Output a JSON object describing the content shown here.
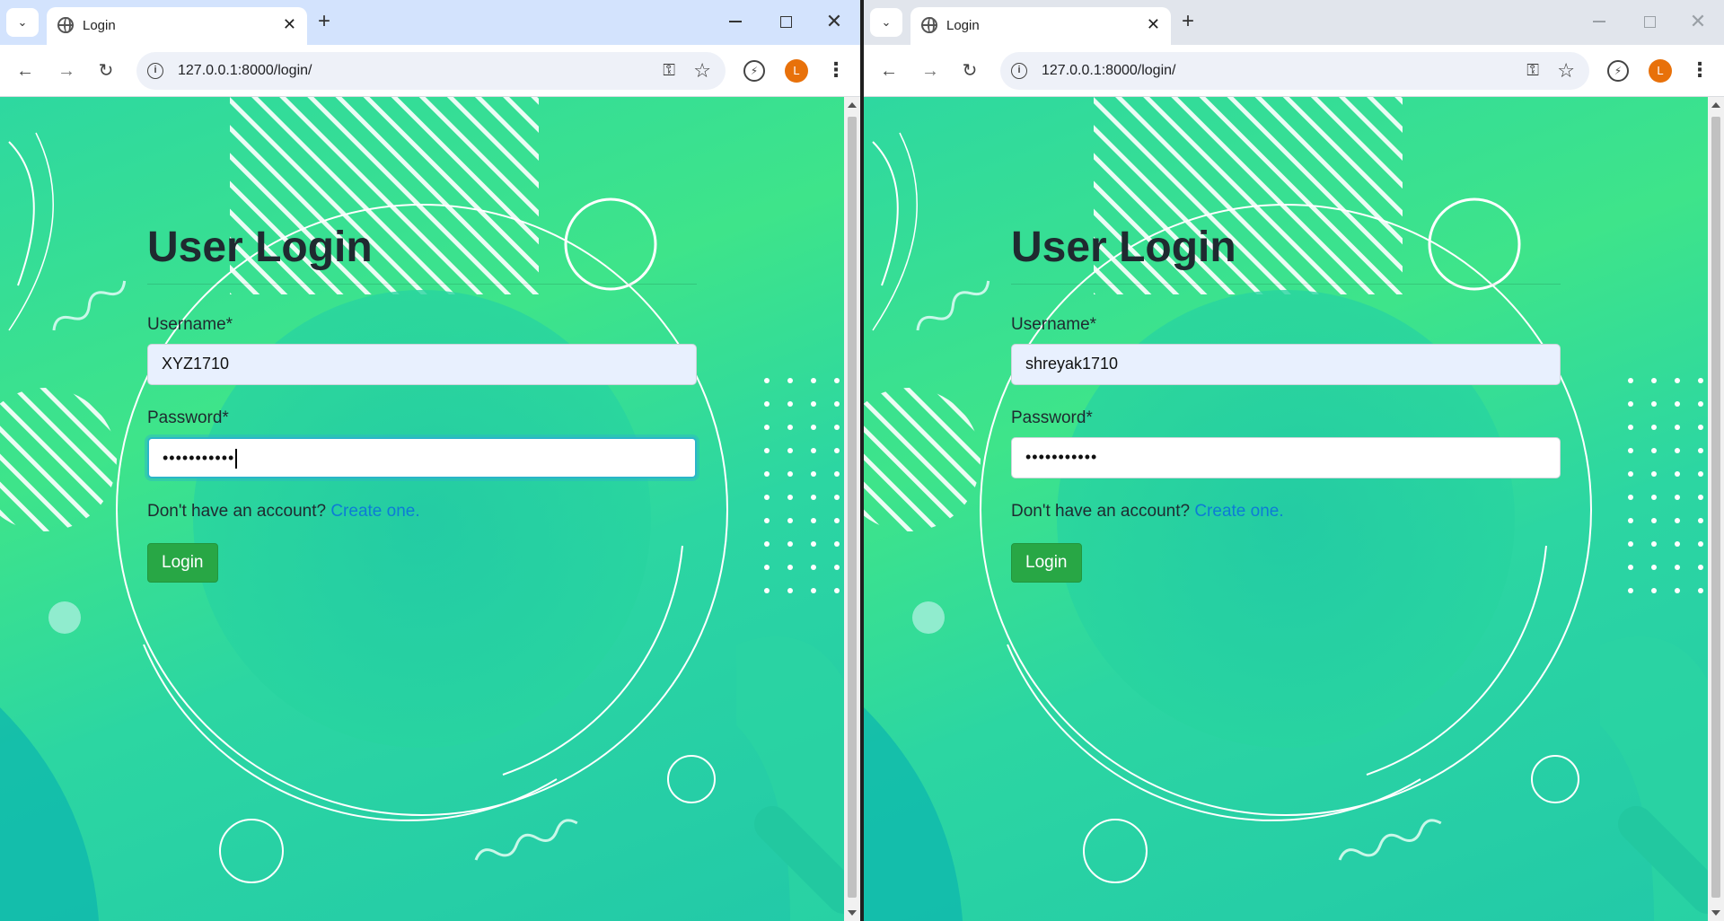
{
  "windows": [
    {
      "tab_title": "Login",
      "url": "127.0.0.1:8000/login/",
      "avatar_letter": "L",
      "page": {
        "heading": "User Login",
        "username_label": "Username*",
        "username_value": "XYZ1710",
        "password_label": "Password*",
        "password_value": "•••••••••••",
        "signup_prompt": "Don't have an account?",
        "signup_link": "Create one.",
        "login_button": "Login"
      }
    },
    {
      "tab_title": "Login",
      "url": "127.0.0.1:8000/login/",
      "avatar_letter": "L",
      "page": {
        "heading": "User Login",
        "username_label": "Username*",
        "username_value": "shreyak1710",
        "password_label": "Password*",
        "password_value": "•••••••••••",
        "signup_prompt": "Don't have an account?",
        "signup_link": "Create one.",
        "login_button": "Login"
      }
    }
  ],
  "icons": {
    "tab_search": "chevron-down-icon",
    "favicon": "globe-icon",
    "tab_close": "close-icon",
    "new_tab": "plus-icon",
    "back": "arrow-left-icon",
    "forward": "arrow-right-icon",
    "reload": "reload-icon",
    "site_info": "info-icon",
    "password_manager": "key-icon",
    "bookmark": "star-icon",
    "extension": "extension-icon",
    "menu": "kebab-menu-icon"
  },
  "colors": {
    "login_button": "#28a745",
    "link": "#0d7bd6",
    "avatar": "#e8710a",
    "active_tabstrip": "#d3e3fd",
    "inactive_tabstrip": "#e1e5ec"
  }
}
